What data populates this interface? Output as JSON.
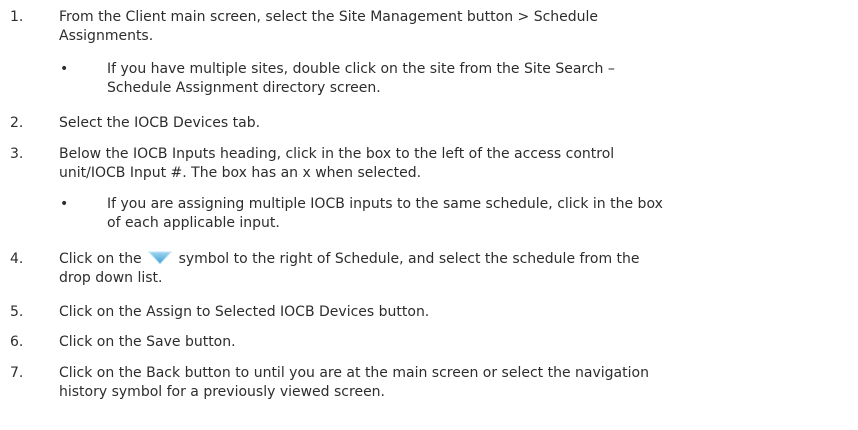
{
  "steps": [
    {
      "num": "1.",
      "lines": [
        "From the Client main screen, select the Site Management button > Schedule",
        "Assignments."
      ]
    },
    {
      "num": "2.",
      "lines": [
        "Select the IOCB Devices tab."
      ]
    },
    {
      "num": "3.",
      "lines": [
        "Below the IOCB Inputs heading, click in the box to the left of the access control",
        "unit/IOCB Input #. The box has an x when selected."
      ]
    },
    {
      "num": "4.",
      "pre": "Click on the",
      "post": "symbol to the right of Schedule, and select the schedule from the",
      "line2": "drop down list.",
      "icon": "dropdown-triangle-icon"
    },
    {
      "num": "5.",
      "lines": [
        "Click on the Assign to Selected IOCB Devices button."
      ]
    },
    {
      "num": "6.",
      "lines": [
        "Click on the Save button."
      ]
    },
    {
      "num": "7.",
      "lines": [
        "Click on the Back button to until you are at the main screen or select the navigation",
        "history symbol for a previously viewed screen."
      ]
    }
  ],
  "bullets": [
    {
      "symbol": "•",
      "lines": [
        "If you have multiple sites, double click on the site from the Site Search –",
        "Schedule Assignment directory screen."
      ]
    },
    {
      "symbol": "•",
      "lines": [
        "If you are assigning multiple IOCB inputs to the same schedule, click in the box",
        "of each applicable input."
      ]
    }
  ],
  "colors": {
    "text": "#2d2d2d",
    "icon": "#5fb2e0"
  }
}
